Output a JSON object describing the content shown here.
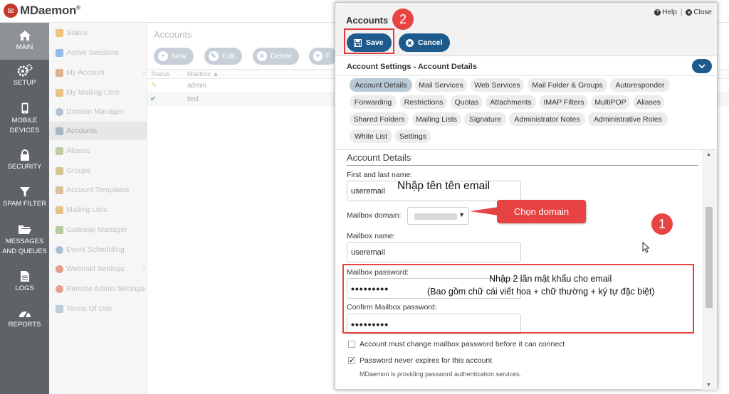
{
  "app": {
    "brand": "MDaemon",
    "trademark": "®"
  },
  "leftnav": [
    {
      "label": "MAIN",
      "icon": "home-icon",
      "active": true
    },
    {
      "label": "SETUP",
      "icon": "gears-icon"
    },
    {
      "label": "MOBILE DEVICES",
      "icon": "mobile-icon"
    },
    {
      "label": "SECURITY",
      "icon": "lock-icon"
    },
    {
      "label": "SPAM FILTER",
      "icon": "filter-icon"
    },
    {
      "label": "MESSAGES AND QUEUES",
      "icon": "folder-icon"
    },
    {
      "label": "LOGS",
      "icon": "document-icon"
    },
    {
      "label": "REPORTS",
      "icon": "gauge-icon"
    }
  ],
  "submenu": [
    {
      "label": "Status",
      "color": "#e6a23c"
    },
    {
      "label": "Active Sessions",
      "color": "#5b9bd5"
    },
    {
      "label": "My Account",
      "color": "#c98a5a",
      "chevron": "›"
    },
    {
      "label": "My Mailing Lists",
      "color": "#d9a441"
    },
    {
      "label": "Domain Manager",
      "color": "#8aa0b4"
    },
    {
      "label": "Accounts",
      "color": "#7a8fa8",
      "active": true
    },
    {
      "label": "Aliases",
      "color": "#9bb36d"
    },
    {
      "label": "Groups",
      "color": "#c7a55b"
    },
    {
      "label": "Account Templates",
      "color": "#c9a263"
    },
    {
      "label": "Mailing Lists",
      "color": "#d4a548"
    },
    {
      "label": "Gateway Manager",
      "color": "#8bb06a"
    },
    {
      "label": "Event Scheduling",
      "color": "#7f9fbf"
    },
    {
      "label": "Webmail Settings",
      "color": "#d9664f",
      "chevron": "›"
    },
    {
      "label": "Remote Admin Settings",
      "color": "#d96a55",
      "chevron": "›"
    },
    {
      "label": "Terms Of Use",
      "color": "#9ab4cc"
    }
  ],
  "main": {
    "title": "Accounts",
    "toolbar": {
      "new": "New",
      "edit": "Edit",
      "delete": "Delete",
      "filter": "F"
    },
    "columns": {
      "status": "Status",
      "mailbox": "Mailbox ▲"
    },
    "rows": [
      {
        "status_icon": "pencil-icon",
        "mailbox": "admin"
      },
      {
        "status_icon": "check-icon",
        "mailbox": "test"
      }
    ]
  },
  "dialog": {
    "title": "Accounts",
    "help": "Help",
    "close": "Close",
    "separator": "|",
    "save": "Save",
    "cancel": "Cancel",
    "settings_title": "Account Settings - Account Details",
    "tabs": [
      "Account Details",
      "Mail Services",
      "Web Services",
      "Mail Folder & Groups",
      "Autoresponder",
      "Forwarding",
      "Restrictions",
      "Quotas",
      "Attachments",
      "IMAP Filters",
      "MultiPOP",
      "Aliases",
      "Shared Folders",
      "Mailing Lists",
      "Signature",
      "Administrator Notes",
      "Administrative Roles",
      "White List",
      "Settings"
    ],
    "form": {
      "section": "Account Details",
      "name_label": "First and last name:",
      "name_value": "useremail",
      "domain_label": "Mailbox domain:",
      "mailbox_label": "Mailbox name:",
      "mailbox_value": "useremail",
      "pw_label": "Mailbox password:",
      "pw_value": "•••••••••",
      "confirm_label": "Confirm Mailbox password:",
      "confirm_value": "•••••••••",
      "chk_change": "Account must change mailbox password before it can connect",
      "chk_never": "Password never expires for this account",
      "chk_never_checked": true,
      "note": "MDaemon is providing password authentication services."
    }
  },
  "annotations": {
    "badge_save": "2",
    "badge_pw": "1",
    "name_hint": "Nhập tên tên email",
    "domain_hint": "Chọn domain",
    "pw_hint_1": "Nhập 2 lần mật khẩu cho email",
    "pw_hint_2": "(Bao gồm chữ cái viết hoa + chữ thường + ký tự đặc biệt)",
    "accent": "#e84343"
  }
}
